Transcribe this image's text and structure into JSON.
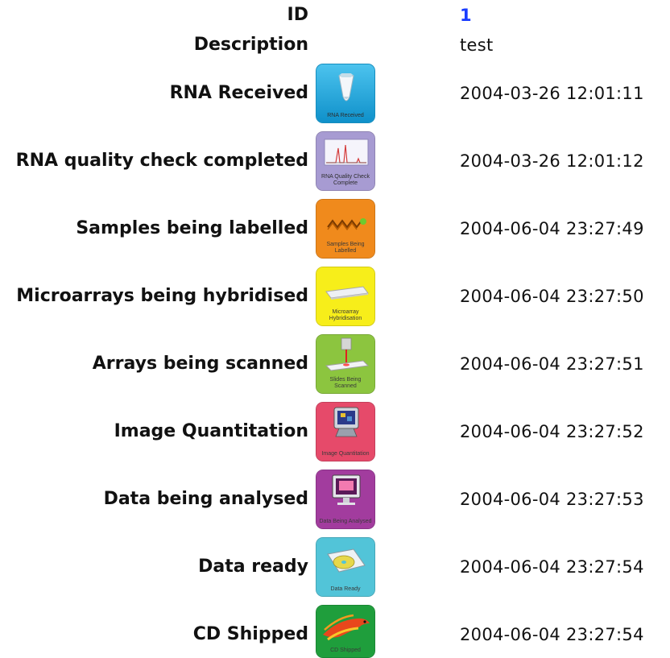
{
  "record": {
    "id_label": "ID",
    "id_value": "1",
    "description_label": "Description",
    "description_value": "test"
  },
  "stages": [
    {
      "label": "RNA Received",
      "timestamp": "2004-03-26 12:01:11",
      "icon": "rna-tube-icon",
      "caption": "RNA Received",
      "color": "#1aa6e0"
    },
    {
      "label": "RNA quality check completed",
      "timestamp": "2004-03-26 12:01:12",
      "icon": "quality-graph-icon",
      "caption": "RNA Quality Check Complete",
      "color": "#a79bd2"
    },
    {
      "label": "Samples being labelled",
      "timestamp": "2004-06-04 23:27:49",
      "icon": "labelling-wave-icon",
      "caption": "Samples Being Labelled",
      "color": "#f08a1c"
    },
    {
      "label": "Microarrays being hybridised",
      "timestamp": "2004-06-04 23:27:50",
      "icon": "microarray-slide-icon",
      "caption": "Microarray Hybridisation",
      "color": "#f7ee1a"
    },
    {
      "label": "Arrays being scanned",
      "timestamp": "2004-06-04 23:27:51",
      "icon": "laser-scanner-icon",
      "caption": "Slides Being Scanned",
      "color": "#8cc53f"
    },
    {
      "label": "Image Quantitation",
      "timestamp": "2004-06-04 23:27:52",
      "icon": "monitor-icon",
      "caption": "Image Quantitation",
      "color": "#e64a6a"
    },
    {
      "label": "Data being analysed",
      "timestamp": "2004-06-04 23:27:53",
      "icon": "computer-analysis-icon",
      "caption": "Data Being Analysed",
      "color": "#a23c9e"
    },
    {
      "label": "Data ready",
      "timestamp": "2004-06-04 23:27:54",
      "icon": "cd-folder-icon",
      "caption": "Data Ready",
      "color": "#52c4d8"
    },
    {
      "label": "CD Shipped",
      "timestamp": "2004-06-04 23:27:54",
      "icon": "eagle-icon",
      "caption": "CD Shipped",
      "color": "#1f9e3c"
    }
  ]
}
